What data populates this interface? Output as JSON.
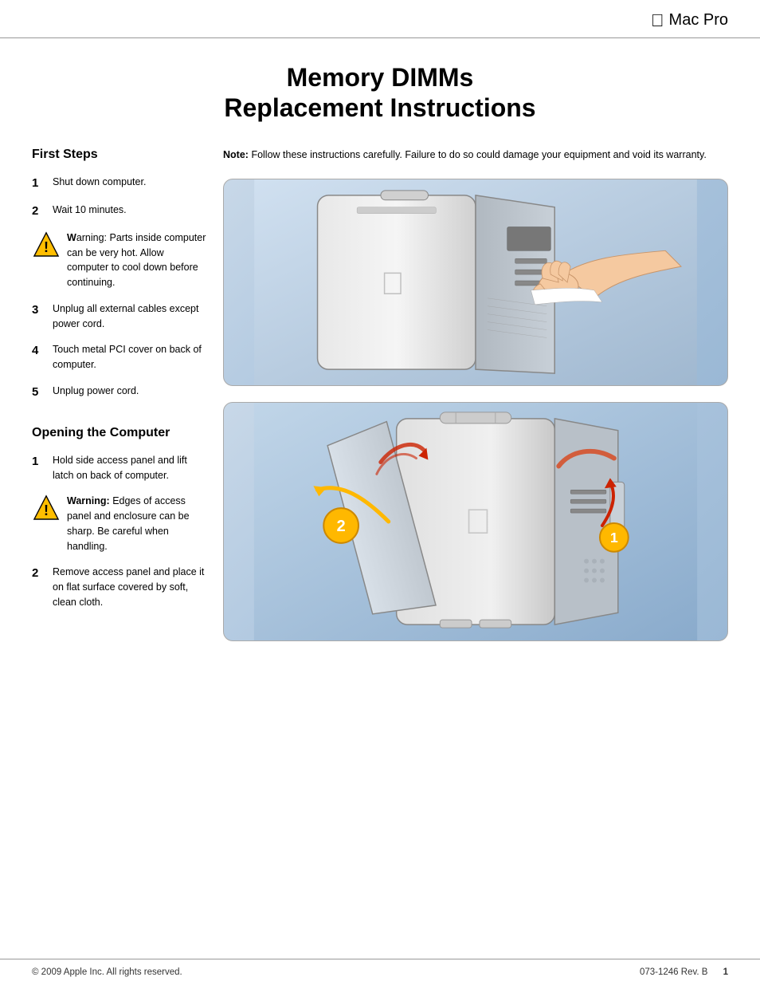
{
  "header": {
    "apple_logo": "&#xF8FF;",
    "brand": "Mac Pro"
  },
  "document": {
    "title_line1": "Memory DIMMs",
    "title_line2": "Replacement Instructions"
  },
  "note": {
    "label": "Note:",
    "text": "Follow these instructions carefully. Failure to do so could damage your equipment and void its warranty."
  },
  "sections": {
    "first_steps": {
      "title": "First Steps",
      "steps": [
        {
          "num": "1",
          "text": "Shut down computer."
        },
        {
          "num": "2",
          "text": "Wait 10 minutes."
        },
        {
          "num": "3",
          "text": "Unplug all external cables except power cord."
        },
        {
          "num": "4",
          "text": "Touch metal PCI cover on back of computer."
        },
        {
          "num": "5",
          "text": "Unplug power cord."
        }
      ],
      "warning": {
        "label": "Warning:",
        "text": "Parts inside computer can be very hot. Allow computer to cool down before continuing."
      }
    },
    "opening": {
      "title": "Opening the Computer",
      "steps": [
        {
          "num": "1",
          "text": "Hold side access panel and lift latch on back of computer."
        },
        {
          "num": "2",
          "text": "Remove access panel and place it on flat surface covered by soft, clean cloth."
        }
      ],
      "warning": {
        "label": "Warning:",
        "text": "Edges of access panel and enclosure can be sharp. Be careful when handling."
      }
    }
  },
  "footer": {
    "copyright": "© 2009 Apple Inc. All rights reserved.",
    "doc_num": "073-1246 Rev. B",
    "page": "1"
  }
}
